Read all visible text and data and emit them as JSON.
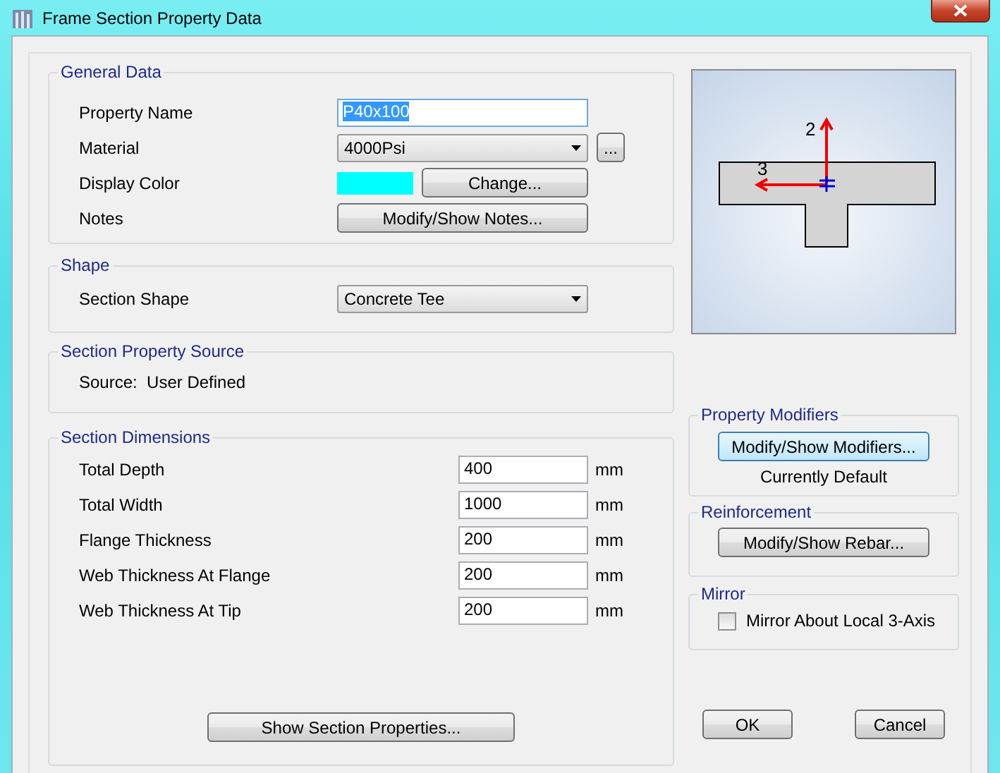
{
  "window": {
    "title": "Frame Section Property Data"
  },
  "general_data": {
    "title": "General Data",
    "property_name": {
      "label": "Property Name",
      "value": "P40x100"
    },
    "material": {
      "label": "Material",
      "value": "4000Psi",
      "more_button": "..."
    },
    "display_color": {
      "label": "Display Color",
      "color": "#00ffff",
      "button": "Change..."
    },
    "notes": {
      "label": "Notes",
      "button": "Modify/Show Notes..."
    }
  },
  "shape": {
    "title": "Shape",
    "label": "Section Shape",
    "value": "Concrete Tee"
  },
  "property_source": {
    "title": "Section Property Source",
    "text": "Source:  User Defined"
  },
  "dimensions": {
    "title": "Section Dimensions",
    "rows": [
      {
        "label": "Total Depth",
        "value": "400",
        "unit": "mm"
      },
      {
        "label": "Total Width",
        "value": "1000",
        "unit": "mm"
      },
      {
        "label": "Flange Thickness",
        "value": "200",
        "unit": "mm"
      },
      {
        "label": "Web Thickness At Flange",
        "value": "200",
        "unit": "mm"
      },
      {
        "label": "Web Thickness At Tip",
        "value": "200",
        "unit": "mm"
      }
    ],
    "button": "Show Section Properties..."
  },
  "preview": {
    "axis_labels": [
      "2",
      "3"
    ]
  },
  "property_modifiers": {
    "title": "Property Modifiers",
    "button": {
      "label": "Modify/Show Modifiers...",
      "focused": true
    },
    "status": "Currently Default"
  },
  "reinforcement": {
    "title": "Reinforcement",
    "button": "Modify/Show Rebar..."
  },
  "mirror": {
    "title": "Mirror",
    "label": "Mirror About Local 3-Axis",
    "checked": false
  },
  "buttons": [
    "OK",
    "Cancel"
  ]
}
